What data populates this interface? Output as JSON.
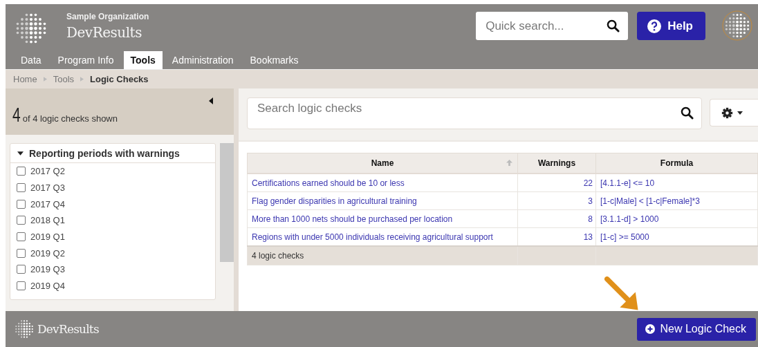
{
  "header": {
    "organization": "Sample Organization",
    "app_name": "DevResults",
    "quick_search": {
      "placeholder": "Quick search..."
    },
    "help_button": "Help"
  },
  "tabs": [
    {
      "label": "Data",
      "selected": false
    },
    {
      "label": "Program Info",
      "selected": false
    },
    {
      "label": "Tools",
      "selected": true
    },
    {
      "label": "Administration",
      "selected": false
    },
    {
      "label": "Bookmarks",
      "selected": false
    }
  ],
  "breadcrumb": [
    "Home",
    "Tools",
    "Logic Checks"
  ],
  "sidebar": {
    "count": "4",
    "count_text": "of 4 logic checks shown",
    "filter": {
      "title": "Reporting periods with warnings",
      "expanded": true,
      "items": [
        {
          "label": "2017 Q2",
          "checked": false
        },
        {
          "label": "2017 Q3",
          "checked": false
        },
        {
          "label": "2017 Q4",
          "checked": false
        },
        {
          "label": "2018 Q1",
          "checked": false
        },
        {
          "label": "2019 Q1",
          "checked": false
        },
        {
          "label": "2019 Q2",
          "checked": false
        },
        {
          "label": "2019 Q3",
          "checked": false
        },
        {
          "label": "2019 Q4",
          "checked": false
        }
      ]
    }
  },
  "search": {
    "placeholder": "Search logic checks"
  },
  "table": {
    "columns": [
      "Name",
      "Warnings",
      "Formula"
    ],
    "rows": [
      {
        "name": "Certifications earned should be 10 or less",
        "warnings": "22",
        "formula": "[4.1.1-e] <= 10"
      },
      {
        "name": "Flag gender disparities in agricultural training",
        "warnings": "3",
        "formula": "[1-c|Male] < [1-c|Female]*3"
      },
      {
        "name": "More than 1000 nets should be purchased per location",
        "warnings": "8",
        "formula": "[3.1.1-d] > 1000"
      },
      {
        "name": "Regions with under 5000 individuals receiving agricultural support",
        "warnings": "13",
        "formula": "[1-c] >= 5000"
      }
    ],
    "footer": "4 logic checks"
  },
  "footer": {
    "app_name": "DevResults",
    "new_button": "New Logic Check"
  }
}
